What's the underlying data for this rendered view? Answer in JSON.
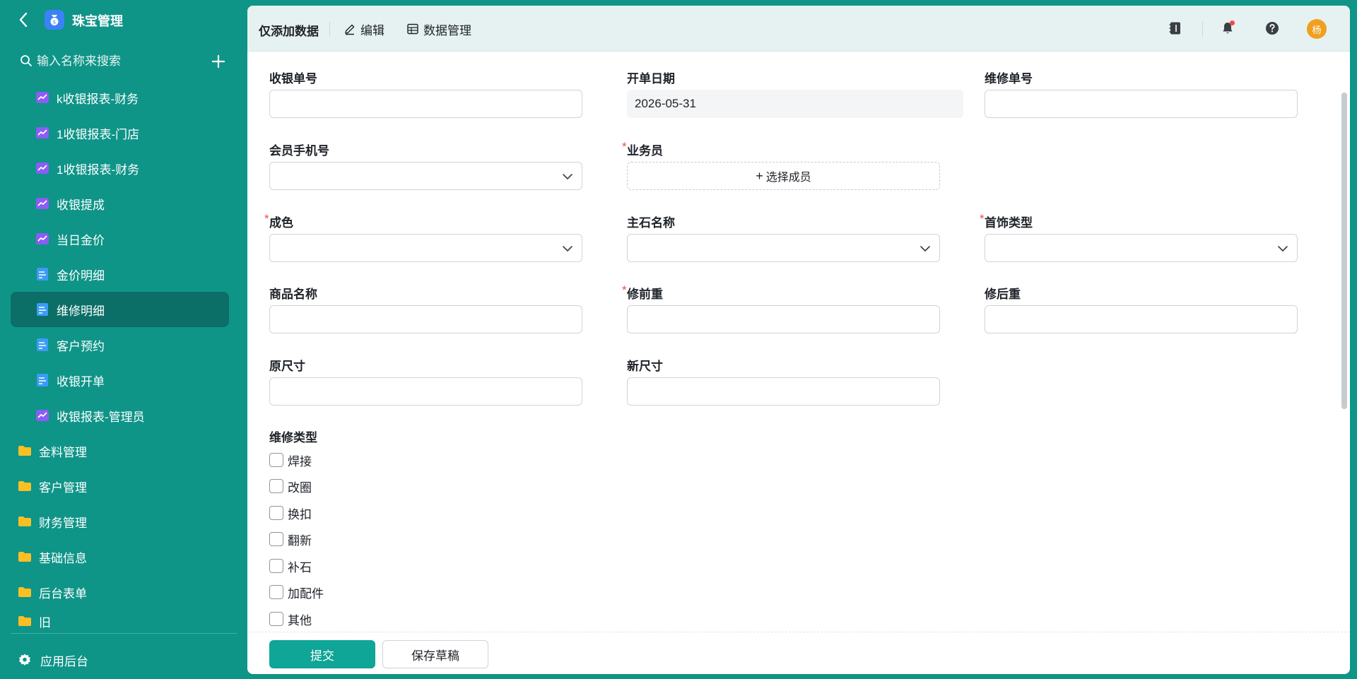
{
  "app": {
    "title": "珠宝管理",
    "search_placeholder": "输入名称来搜索",
    "footer_label": "应用后台"
  },
  "sidebar": {
    "items": [
      {
        "label": "k收银报表-财务",
        "icon": "chart-icon",
        "kind": "child"
      },
      {
        "label": "1收银报表-门店",
        "icon": "chart-icon",
        "kind": "child"
      },
      {
        "label": "1收银报表-财务",
        "icon": "chart-icon",
        "kind": "child"
      },
      {
        "label": "收银提成",
        "icon": "chart-icon",
        "kind": "child"
      },
      {
        "label": "当日金价",
        "icon": "chart-icon",
        "kind": "child"
      },
      {
        "label": "金价明细",
        "icon": "form-icon",
        "kind": "child"
      },
      {
        "label": "维修明细",
        "icon": "form-icon",
        "kind": "child",
        "active": true
      },
      {
        "label": "客户预约",
        "icon": "form-icon",
        "kind": "child"
      },
      {
        "label": "收银开单",
        "icon": "form-icon",
        "kind": "child"
      },
      {
        "label": "收银报表-管理员",
        "icon": "chart-icon",
        "kind": "child"
      },
      {
        "label": "金料管理",
        "icon": "folder-icon",
        "kind": "folder"
      },
      {
        "label": "客户管理",
        "icon": "folder-icon",
        "kind": "folder"
      },
      {
        "label": "财务管理",
        "icon": "folder-icon",
        "kind": "folder"
      },
      {
        "label": "基础信息",
        "icon": "folder-icon",
        "kind": "folder"
      },
      {
        "label": "后台表单",
        "icon": "folder-icon",
        "kind": "folder"
      },
      {
        "label": "旧",
        "icon": "folder-icon",
        "kind": "folder"
      }
    ]
  },
  "toolbar": {
    "title": "仅添加数据",
    "edit_label": "编辑",
    "data_manage_label": "数据管理",
    "avatar_text": "杨"
  },
  "form": {
    "receipt_no": {
      "label": "收银单号",
      "value": ""
    },
    "open_date": {
      "label": "开单日期",
      "value": "2026-05-31"
    },
    "repair_no": {
      "label": "维修单号",
      "value": ""
    },
    "member_phone": {
      "label": "会员手机号",
      "value": ""
    },
    "salesperson": {
      "label": "业务员",
      "required": true,
      "button_label": "选择成员"
    },
    "purity": {
      "label": "成色",
      "required": true,
      "value": ""
    },
    "main_stone": {
      "label": "主石名称",
      "value": ""
    },
    "jewelry_type": {
      "label": "首饰类型",
      "required": true,
      "value": ""
    },
    "product_name": {
      "label": "商品名称",
      "value": ""
    },
    "weight_before": {
      "label": "修前重",
      "required": true,
      "value": ""
    },
    "weight_after": {
      "label": "修后重",
      "value": ""
    },
    "orig_size": {
      "label": "原尺寸",
      "value": ""
    },
    "new_size": {
      "label": "新尺寸",
      "value": ""
    },
    "repair_type": {
      "label": "维修类型",
      "options": [
        {
          "label": "焊接",
          "checked": false
        },
        {
          "label": "改圈",
          "checked": false
        },
        {
          "label": "换扣",
          "checked": false
        },
        {
          "label": "翻新",
          "checked": false
        },
        {
          "label": "补石",
          "checked": false
        },
        {
          "label": "加配件",
          "checked": false
        },
        {
          "label": "其他",
          "checked": false
        }
      ]
    }
  },
  "actions": {
    "submit_label": "提交",
    "save_draft_label": "保存草稿"
  },
  "colors": {
    "brand": "#0f9488",
    "primary_button": "#0fa597",
    "required_mark": "#f54a45",
    "avatar": "#f0a020"
  }
}
